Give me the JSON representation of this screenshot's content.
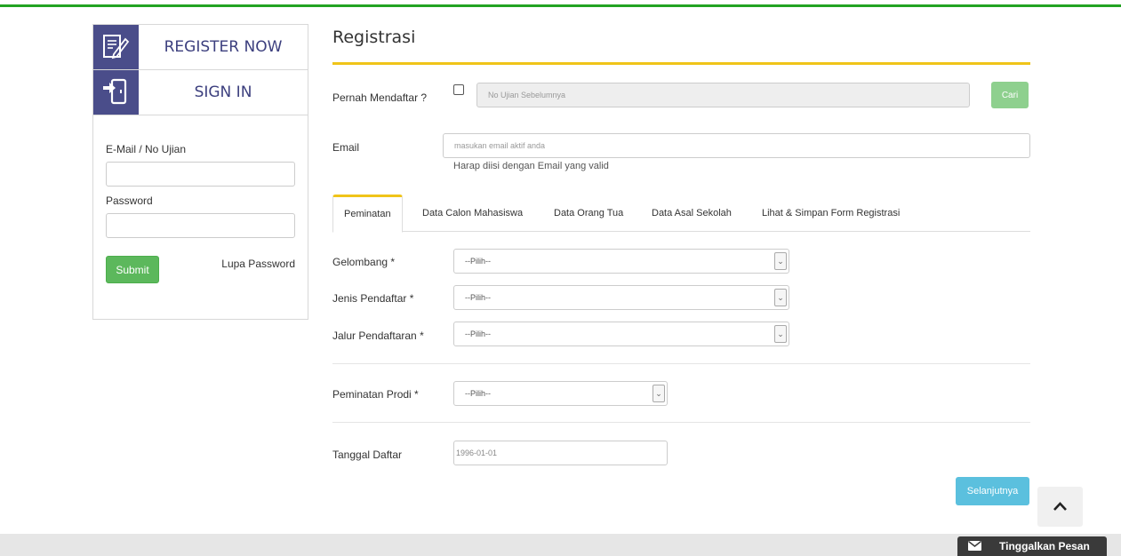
{
  "sidebar": {
    "register_label": "REGISTER NOW",
    "signin_label": "SIGN IN",
    "email_label": "E-Mail / No Ujian",
    "password_label": "Password",
    "submit_label": "Submit",
    "forgot_label": "Lupa Password"
  },
  "main": {
    "title": "Registrasi",
    "pernah_label": "Pernah Mendaftar ?",
    "no_ujian_placeholder": "No Ujian Sebelumnya",
    "cari_label": "Cari",
    "email_label": "Email",
    "email_placeholder": "masukan email aktif anda",
    "email_help": "Harap diisi dengan Email yang valid",
    "tabs": [
      {
        "label": "Peminatan",
        "active": true
      },
      {
        "label": "Data Calon Mahasiswa",
        "active": false
      },
      {
        "label": "Data Orang Tua",
        "active": false
      },
      {
        "label": "Data Asal Sekolah",
        "active": false
      },
      {
        "label": "Lihat & Simpan Form Registrasi",
        "active": false
      }
    ],
    "fields": {
      "gelombang_label": "Gelombang *",
      "gelombang_value": "--Pilih--",
      "jenis_label": "Jenis Pendaftar *",
      "jenis_value": "--Pilih--",
      "jalur_label": "Jalur Pendaftaran *",
      "jalur_value": "--Pilih--",
      "prodi_label": "Peminatan Prodi *",
      "prodi_value": "--Pilih--",
      "tanggal_label": "Tanggal Daftar",
      "tanggal_value": "1996-01-01"
    },
    "next_label": "Selanjutnya"
  },
  "footer": {
    "message_label": "Tinggalkan Pesan"
  },
  "colors": {
    "accent_green": "#23a323",
    "accent_yellow": "#f0c419",
    "sidebar_icon_bg": "#4a4d8a",
    "submit_green": "#5cb85c",
    "next_blue": "#5bc0de"
  }
}
